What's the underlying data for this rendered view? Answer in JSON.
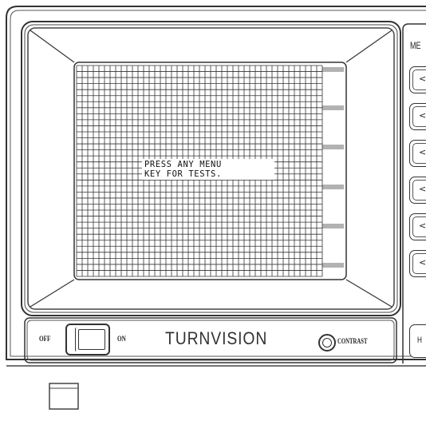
{
  "screen": {
    "message_lines": [
      "PRESS ANY MENU",
      "KEY FOR TESTS."
    ]
  },
  "menu": {
    "label": "ME",
    "buttons": [
      "<",
      "<",
      "<",
      "<",
      "<",
      "<"
    ],
    "help_label": "H"
  },
  "controls": {
    "off_label": "OFF",
    "on_label": "ON",
    "brand": "TURNVISION",
    "contrast_label": "CONTRAST"
  }
}
